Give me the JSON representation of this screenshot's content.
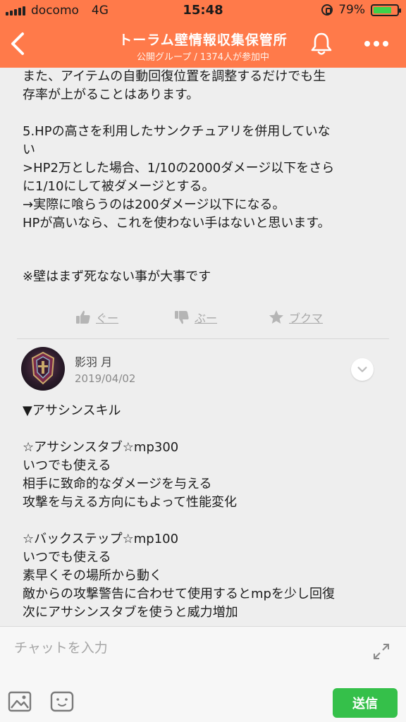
{
  "status_bar": {
    "carrier": "docomo",
    "network": "4G",
    "time": "15:48",
    "battery": "79%",
    "battery_level": 0.79
  },
  "header": {
    "title": "トーラム壁情報収集保管所",
    "subtitle": "公開グループ / 1374人が参加中"
  },
  "post1": {
    "lines": [
      "また、アイテムの自動回復位置を調整するだけでも生",
      "存率が上がることはあります。",
      "",
      "5.HPの高さを利用したサンクチュアリを併用していな",
      "い",
      ">HP2万とした場合、1/10の2000ダメージ以下をさら",
      "に1/10にして被ダメージとする。",
      "→実際に喰らうのは200ダメージ以下になる。",
      "HPが高いなら、これを使わない手はないと思います。",
      "",
      "",
      "※壁はまず死なない事が大事です"
    ]
  },
  "reactions": {
    "good": "ぐー",
    "boo": "ぶー",
    "bookmark": "ブクマ"
  },
  "post2": {
    "author": "影羽 月",
    "date": "2019/04/02",
    "lines": [
      "▼アサシンスキル",
      "",
      "☆アサシンスタブ☆mp300",
      "いつでも使える",
      "相手に致命的なダメージを与える",
      "攻撃を与える方向にもよって性能変化",
      "",
      "☆バックステップ☆mp100",
      "いつでも使える",
      "素早くその場所から動く",
      "敵からの攻撃警告に合わせて使用するとmpを少し回復",
      "次にアサシンスタブを使うと威力増加"
    ]
  },
  "chat": {
    "placeholder": "チャットを入力",
    "send_label": "送信"
  },
  "colors": {
    "header": "#ff7a4a",
    "send": "#35c04a",
    "battery": "#3cd24a"
  }
}
